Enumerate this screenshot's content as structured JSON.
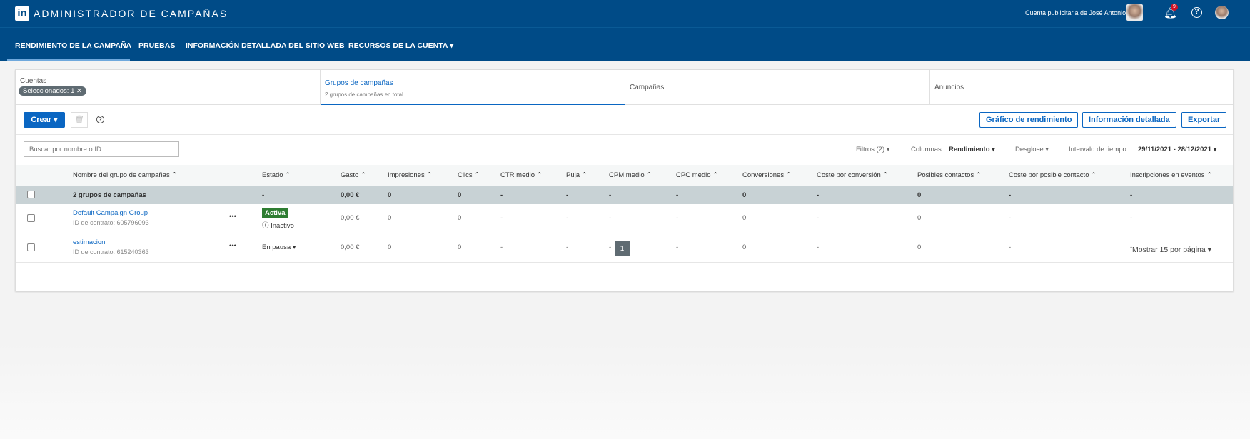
{
  "header": {
    "logo": "in",
    "title": "ADMINISTRADOR DE CAMPAÑAS",
    "account": "Cuenta publicitaria de José Antonio",
    "notifications": "9",
    "help": "?"
  },
  "nav": [
    "RENDIMIENTO DE LA CAMPAÑA",
    "PRUEBAS",
    "INFORMACIÓN DETALLADA DEL SITIO WEB",
    "RECURSOS DE LA CUENTA ▾"
  ],
  "tabs": {
    "cuentas": "Cuentas",
    "selected": "Seleccionados: 1 ✕",
    "grupos": "Grupos de campañas",
    "grupos_sub": "2 grupos de campañas en total",
    "campanas": "Campañas",
    "anuncios": "Anuncios"
  },
  "toolbar": {
    "create": "Crear ▾",
    "trash": "🗑",
    "help": "?",
    "chart": "Gráfico de rendimiento",
    "insights": "Información detallada",
    "export": "Exportar"
  },
  "filters": {
    "search_placeholder": "Buscar por nombre o ID",
    "filtros": "Filtros (2) ▾",
    "columnas_label": "Columnas:",
    "columnas": "Rendimiento ▾",
    "desglose": "Desglose ▾",
    "intervalo_label": "Intervalo de tiempo:",
    "intervalo": "29/11/2021 - 28/12/2021 ▾"
  },
  "columns": [
    "Nombre del grupo de campañas ⌃",
    "Estado ⌃",
    "Gasto ⌃",
    "Impresiones ⌃",
    "Clics ⌃",
    "CTR medio ⌃",
    "Puja ⌃",
    "CPM medio ⌃",
    "CPC medio ⌃",
    "Conversiones ⌃",
    "Coste por conversión ⌃",
    "Posibles contactos ⌃",
    "Coste por posible contacto ⌃",
    "Inscripciones en eventos ⌃"
  ],
  "summary": [
    "2 grupos de campañas",
    "-",
    "0,00 €",
    "0",
    "0",
    "-",
    "-",
    "-",
    "-",
    "0",
    "-",
    "0",
    "-",
    "-"
  ],
  "rows": [
    {
      "name": "Default Campaign Group",
      "contract": "ID de contrato: 605796093",
      "status": "Activa",
      "substatus": "ⓘ Inactivo",
      "values": [
        "0,00 €",
        "0",
        "0",
        "-",
        "-",
        "-",
        "-",
        "0",
        "-",
        "0",
        "-",
        "-"
      ]
    },
    {
      "name": "estimacion",
      "contract": "ID de contrato: 615240363",
      "status": "En pausa ▾",
      "values": [
        "0,00 €",
        "0",
        "0",
        "-",
        "-",
        "-",
        "-",
        "0",
        "-",
        "0",
        "-",
        "-"
      ]
    }
  ],
  "pagination": {
    "page": "1",
    "per_page": "Mostrar 15 por página ▾"
  }
}
